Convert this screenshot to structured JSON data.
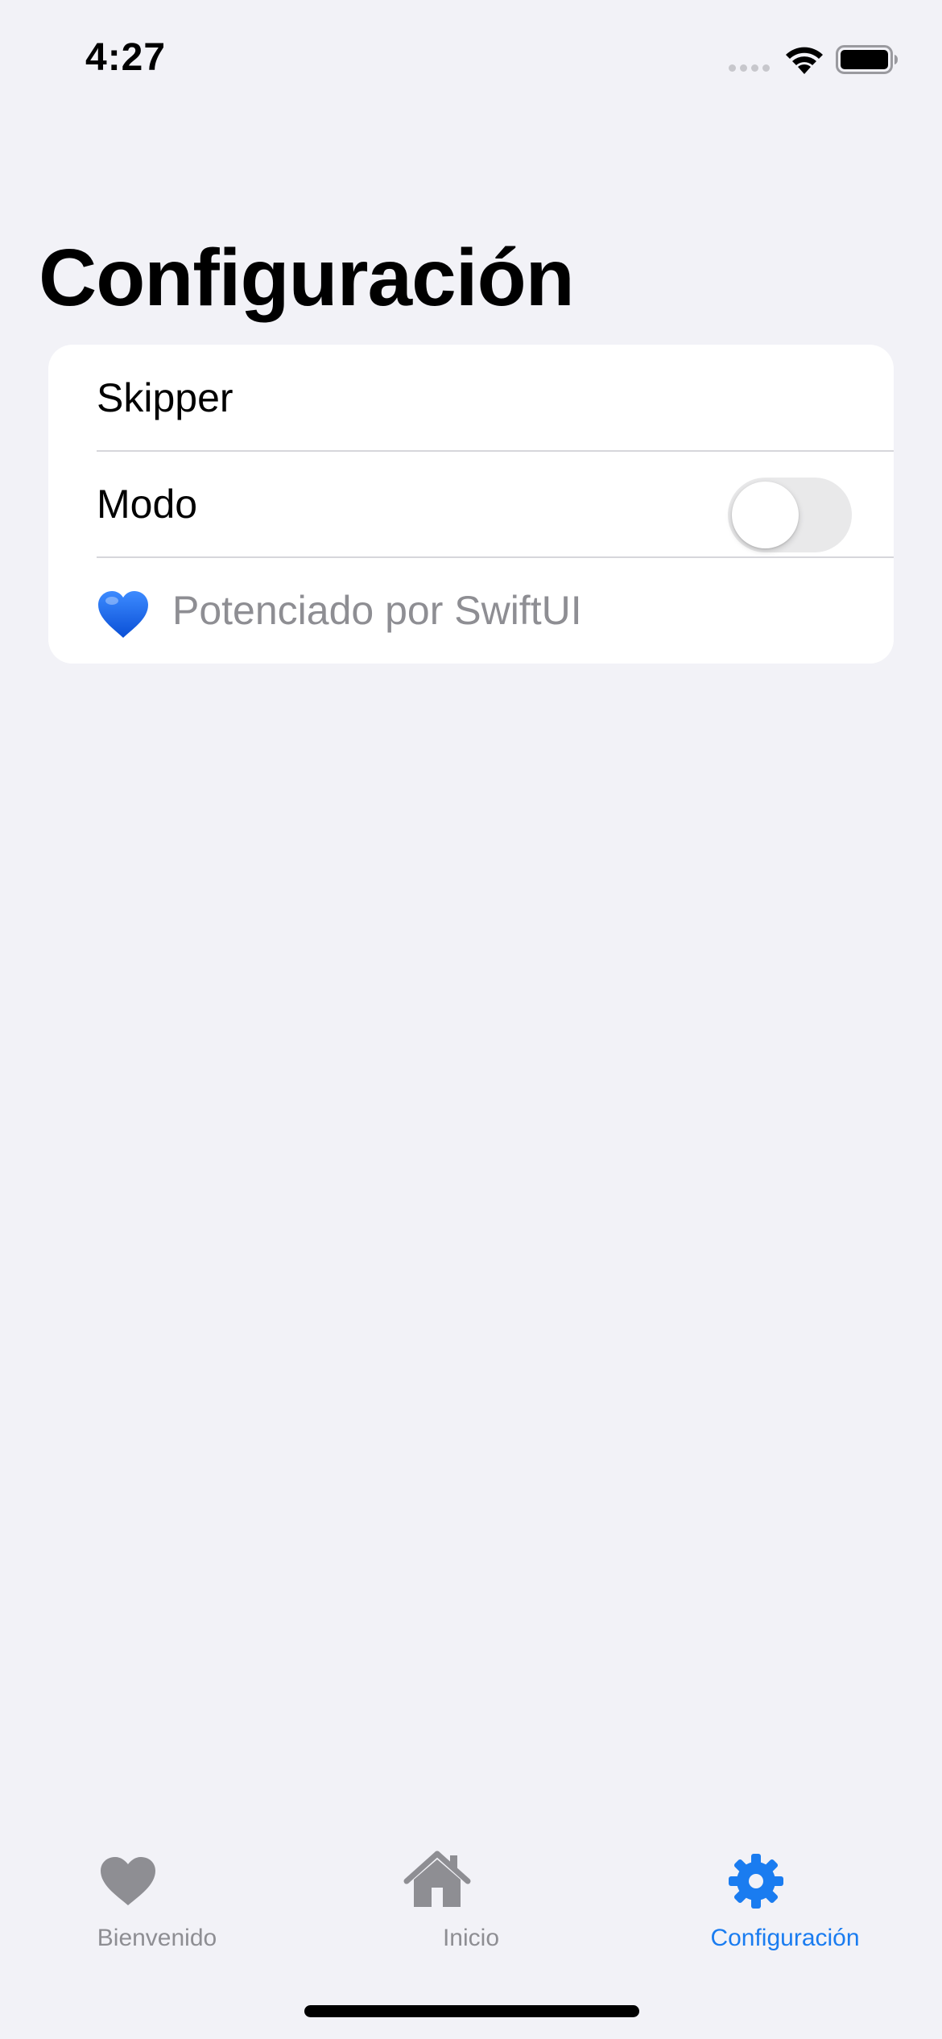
{
  "status_bar": {
    "time": "4:27"
  },
  "page": {
    "title": "Configuración"
  },
  "settings": {
    "rows": [
      {
        "label": "Skipper"
      },
      {
        "label": "Modo",
        "toggle_on": false
      },
      {
        "label": "Potenciado por SwiftUI",
        "icon": "blue-heart-emoji"
      }
    ]
  },
  "tab_bar": {
    "tabs": [
      {
        "label": "Bienvenido",
        "icon": "heart-icon",
        "selected": false
      },
      {
        "label": "Inicio",
        "icon": "house-icon",
        "selected": false
      },
      {
        "label": "Configuración",
        "icon": "gear-icon",
        "selected": true
      }
    ],
    "active_color": "#1a7cf0",
    "inactive_color": "#8e8e93"
  }
}
